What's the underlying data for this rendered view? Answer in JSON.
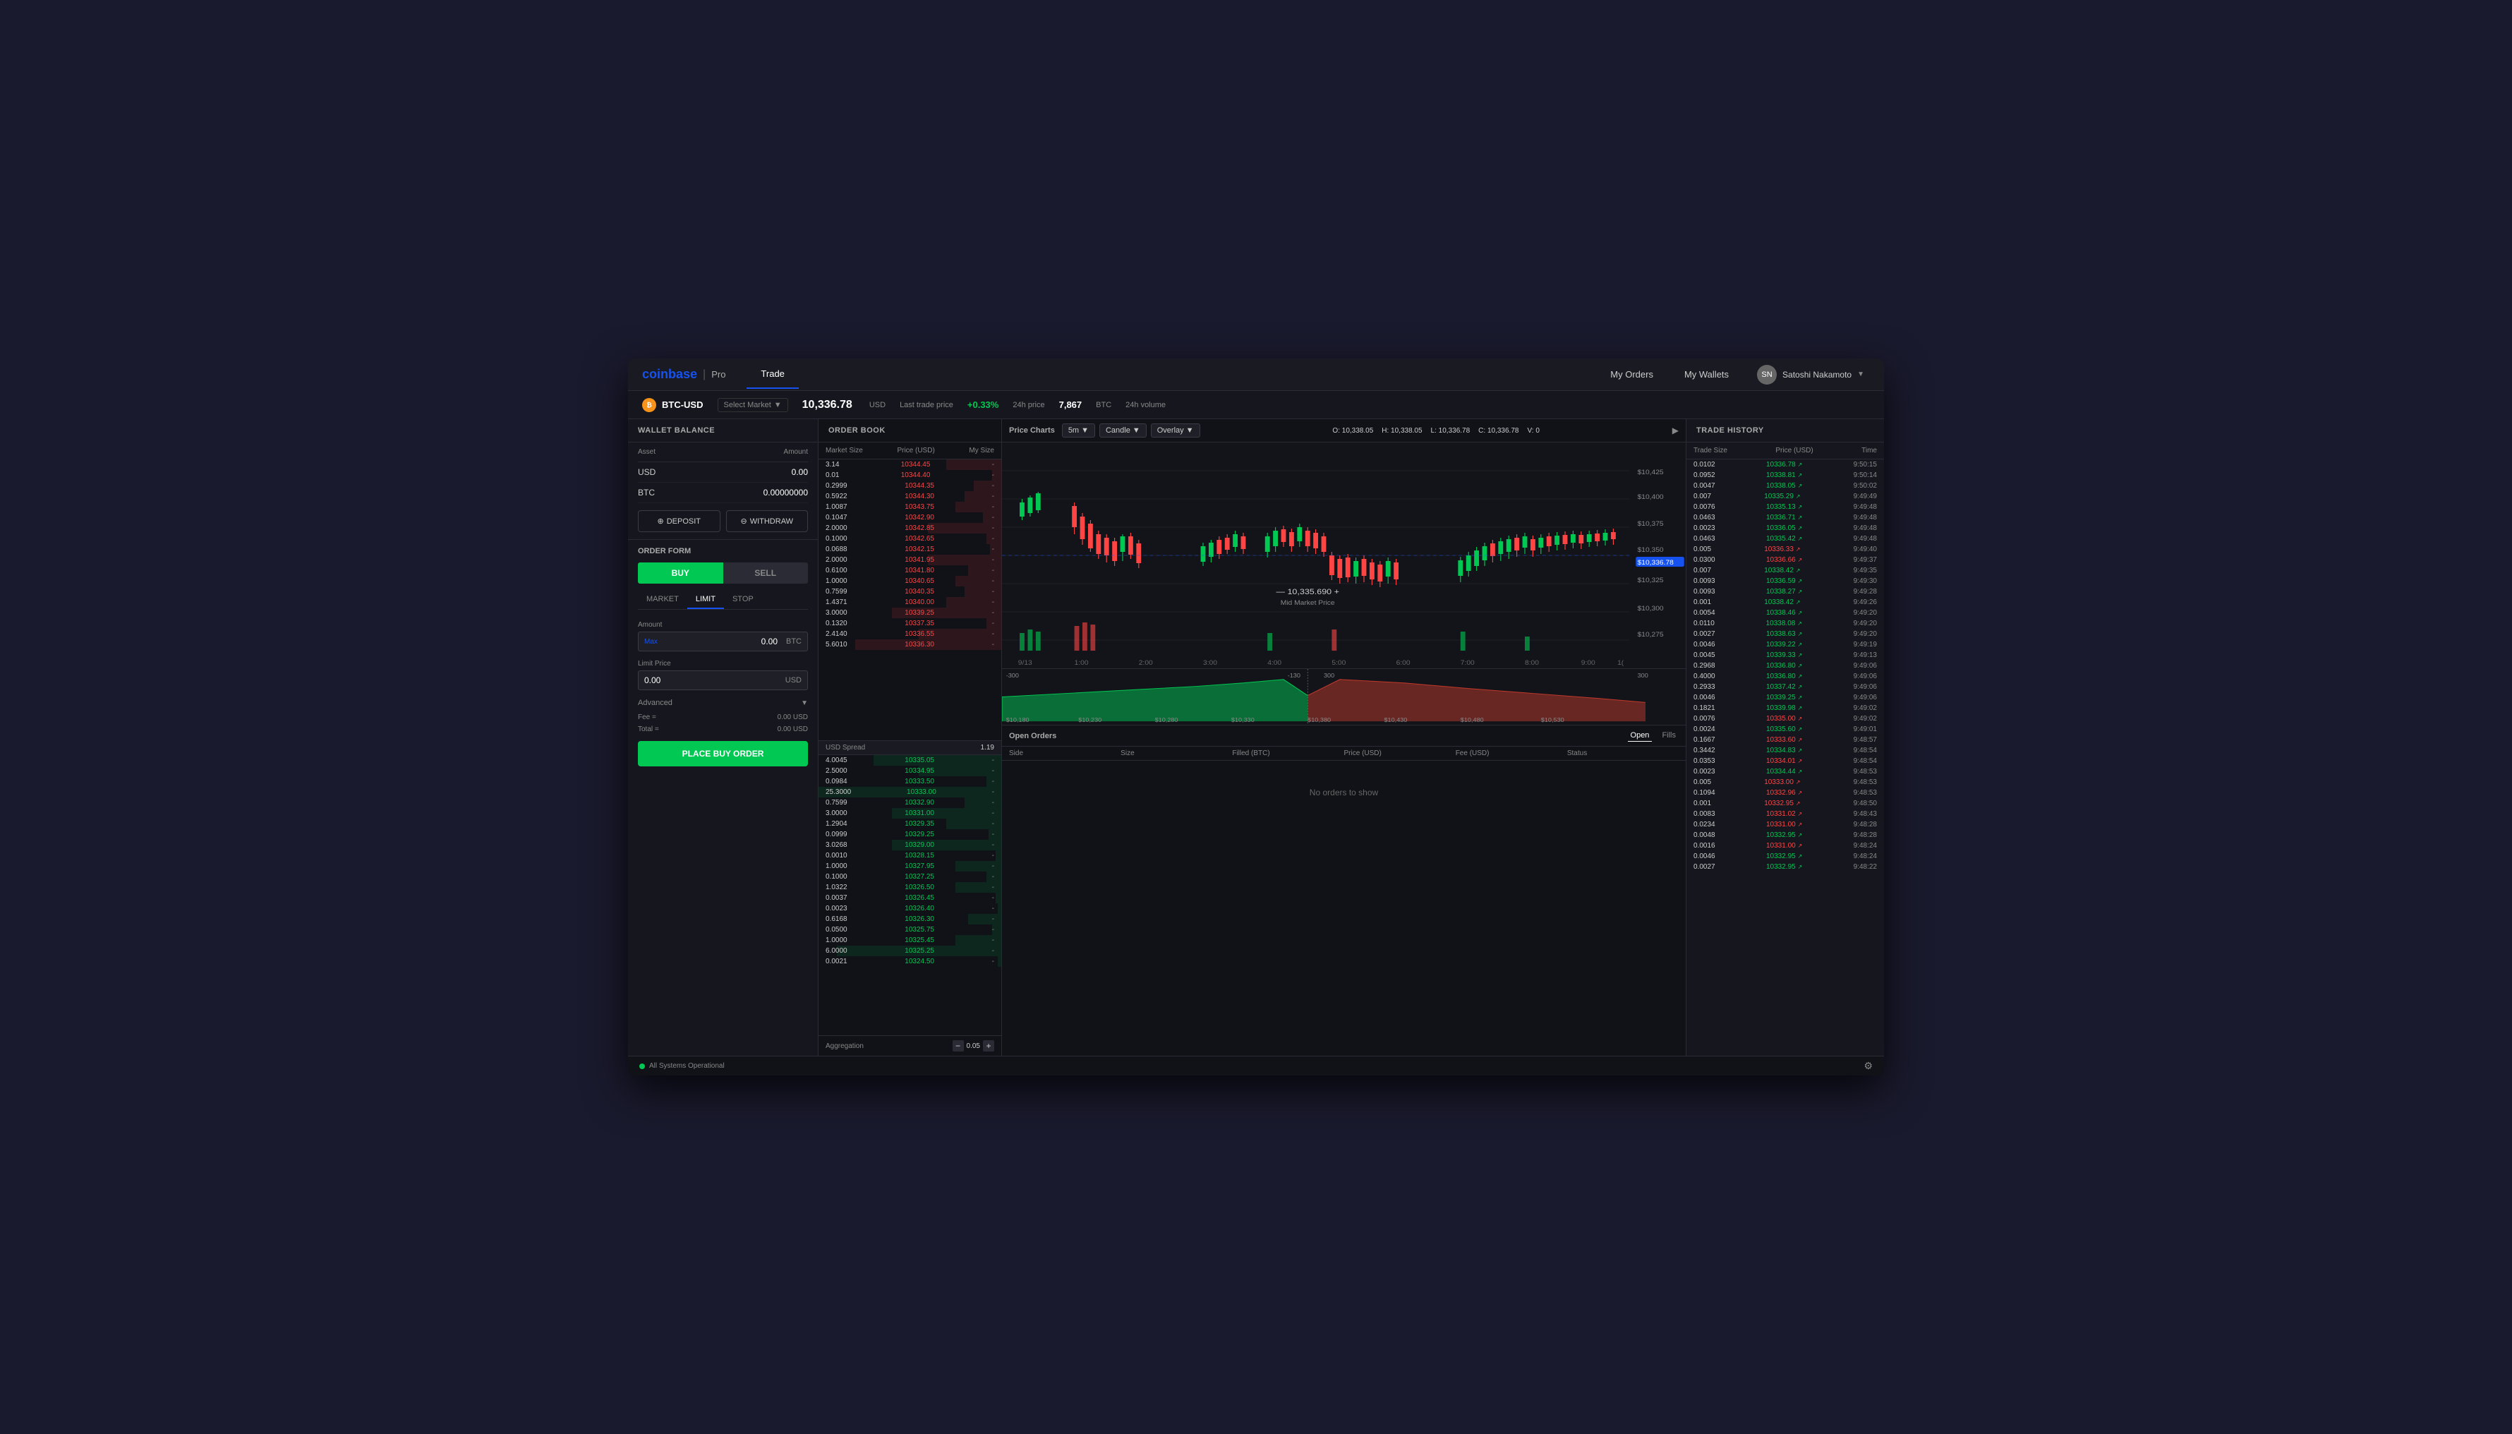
{
  "app": {
    "title": "Coinbase Pro"
  },
  "nav": {
    "logo_main": "coinbase",
    "logo_sub": "Pro",
    "tabs": [
      {
        "label": "Trade",
        "active": true
      }
    ],
    "right_links": [
      "My Orders",
      "My Wallets"
    ],
    "user_name": "Satoshi Nakamoto"
  },
  "market_bar": {
    "pair": "BTC-USD",
    "select_label": "Select Market",
    "last_price": "10,336.78",
    "price_unit": "USD",
    "price_label": "Last trade price",
    "price_change": "+0.33%",
    "change_label": "24h price",
    "volume": "7,867",
    "volume_unit": "BTC",
    "volume_label": "24h volume"
  },
  "sidebar": {
    "wallet_balance_title": "Wallet Balance",
    "col_asset": "Asset",
    "col_amount": "Amount",
    "assets": [
      {
        "name": "USD",
        "amount": "0.00"
      },
      {
        "name": "BTC",
        "amount": "0.00000000"
      }
    ],
    "deposit_label": "DEPOSIT",
    "withdraw_label": "WITHDRAW",
    "order_form_title": "Order Form",
    "buy_label": "BUY",
    "sell_label": "SELL",
    "order_types": [
      "MARKET",
      "LIMIT",
      "STOP"
    ],
    "active_order_type": "LIMIT",
    "amount_label": "Amount",
    "amount_max": "Max",
    "amount_value": "0.00",
    "amount_unit": "BTC",
    "limit_price_label": "Limit Price",
    "limit_price_value": "0.00",
    "limit_price_unit": "USD",
    "advanced_label": "Advanced",
    "fee_label": "Fee =",
    "fee_value": "0.00 USD",
    "total_label": "Total =",
    "total_value": "0.00 USD",
    "place_order_label": "PLACE BUY ORDER"
  },
  "order_book": {
    "title": "Order Book",
    "col_market_size": "Market Size",
    "col_price": "Price (USD)",
    "col_my_size": "My Size",
    "asks": [
      {
        "size": "3.14",
        "price": "10344.45",
        "my_size": "-",
        "pct": 30
      },
      {
        "size": "0.01",
        "price": "10344.40",
        "my_size": "-",
        "pct": 5
      },
      {
        "size": "0.2999",
        "price": "10344.35",
        "my_size": "-",
        "pct": 15
      },
      {
        "size": "0.5922",
        "price": "10344.30",
        "my_size": "-",
        "pct": 20
      },
      {
        "size": "1.0087",
        "price": "10343.75",
        "my_size": "-",
        "pct": 25
      },
      {
        "size": "0.1047",
        "price": "10342.90",
        "my_size": "-",
        "pct": 10
      },
      {
        "size": "2.0000",
        "price": "10342.85",
        "my_size": "-",
        "pct": 40
      },
      {
        "size": "0.1000",
        "price": "10342.65",
        "my_size": "-",
        "pct": 8
      },
      {
        "size": "0.0688",
        "price": "10342.15",
        "my_size": "-",
        "pct": 6
      },
      {
        "size": "2.0000",
        "price": "10341.95",
        "my_size": "-",
        "pct": 40
      },
      {
        "size": "0.6100",
        "price": "10341.80",
        "my_size": "-",
        "pct": 18
      },
      {
        "size": "1.0000",
        "price": "10340.65",
        "my_size": "-",
        "pct": 25
      },
      {
        "size": "0.7599",
        "price": "10340.35",
        "my_size": "-",
        "pct": 20
      },
      {
        "size": "1.4371",
        "price": "10340.00",
        "my_size": "-",
        "pct": 30
      },
      {
        "size": "3.0000",
        "price": "10339.25",
        "my_size": "-",
        "pct": 60
      },
      {
        "size": "0.1320",
        "price": "10337.35",
        "my_size": "-",
        "pct": 8
      },
      {
        "size": "2.4140",
        "price": "10336.55",
        "my_size": "-",
        "pct": 45
      },
      {
        "size": "5.6010",
        "price": "10336.30",
        "my_size": "-",
        "pct": 80
      }
    ],
    "spread_label": "USD Spread",
    "spread_value": "1.19",
    "bids": [
      {
        "size": "4.0045",
        "price": "10335.05",
        "my_size": "-",
        "pct": 70
      },
      {
        "size": "2.5000",
        "price": "10334.95",
        "my_size": "-",
        "pct": 45
      },
      {
        "size": "0.0984",
        "price": "10333.50",
        "my_size": "-",
        "pct": 8
      },
      {
        "size": "25.3000",
        "price": "10333.00",
        "my_size": "-",
        "pct": 100
      },
      {
        "size": "0.7599",
        "price": "10332.90",
        "my_size": "-",
        "pct": 20
      },
      {
        "size": "3.0000",
        "price": "10331.00",
        "my_size": "-",
        "pct": 60
      },
      {
        "size": "1.2904",
        "price": "10329.35",
        "my_size": "-",
        "pct": 30
      },
      {
        "size": "0.0999",
        "price": "10329.25",
        "my_size": "-",
        "pct": 7
      },
      {
        "size": "3.0268",
        "price": "10329.00",
        "my_size": "-",
        "pct": 60
      },
      {
        "size": "0.0010",
        "price": "10328.15",
        "my_size": "-",
        "pct": 3
      },
      {
        "size": "1.0000",
        "price": "10327.95",
        "my_size": "-",
        "pct": 25
      },
      {
        "size": "0.1000",
        "price": "10327.25",
        "my_size": "-",
        "pct": 8
      },
      {
        "size": "1.0322",
        "price": "10326.50",
        "my_size": "-",
        "pct": 25
      },
      {
        "size": "0.0037",
        "price": "10326.45",
        "my_size": "-",
        "pct": 3
      },
      {
        "size": "0.0023",
        "price": "10326.40",
        "my_size": "-",
        "pct": 2
      },
      {
        "size": "0.6168",
        "price": "10326.30",
        "my_size": "-",
        "pct": 18
      },
      {
        "size": "0.0500",
        "price": "10325.75",
        "my_size": "-",
        "pct": 5
      },
      {
        "size": "1.0000",
        "price": "10325.45",
        "my_size": "-",
        "pct": 25
      },
      {
        "size": "6.0000",
        "price": "10325.25",
        "my_size": "-",
        "pct": 90
      },
      {
        "size": "0.0021",
        "price": "10324.50",
        "my_size": "-",
        "pct": 2
      }
    ],
    "aggregation_label": "Aggregation",
    "aggregation_value": "0.05"
  },
  "price_charts": {
    "title": "Price Charts",
    "timeframe": "5m",
    "chart_type": "Candle",
    "overlay": "Overlay",
    "ohlcv": {
      "o_label": "O:",
      "o_val": "10,338.05",
      "h_label": "H:",
      "h_val": "10,338.05",
      "l_label": "L:",
      "l_val": "10,336.78",
      "c_label": "C:",
      "c_val": "10,336.78",
      "v_label": "V:",
      "v_val": "0"
    },
    "price_ticks": [
      "$10,425",
      "$10,400",
      "$10,375",
      "$10,350",
      "$10,336.78",
      "$10,325",
      "$10,300",
      "$10,275"
    ],
    "mid_market_price": "10,335.690",
    "mid_market_label": "Mid Market Price",
    "time_labels": [
      "9/13",
      "1:00",
      "2:00",
      "3:00",
      "4:00",
      "5:00",
      "6:00",
      "7:00",
      "8:00",
      "9:00",
      "1("
    ],
    "depth_labels_left": [
      "-300",
      "-130"
    ],
    "depth_labels_right": [
      "300",
      "300"
    ],
    "depth_prices": [
      "$10,180",
      "$10,230",
      "$10,280",
      "$10,330",
      "$10,380",
      "$10,430",
      "$10,480",
      "$10,530"
    ]
  },
  "open_orders": {
    "title": "Open Orders",
    "tab_open": "Open",
    "tab_fills": "Fills",
    "col_side": "Side",
    "col_size": "Size",
    "col_filled": "Filled (BTC)",
    "col_price": "Price (USD)",
    "col_fee": "Fee (USD)",
    "col_status": "Status",
    "empty_message": "No orders to show"
  },
  "trade_history": {
    "title": "Trade History",
    "col_trade_size": "Trade Size",
    "col_price": "Price (USD)",
    "col_time": "Time",
    "trades": [
      {
        "size": "0.0102",
        "price": "10336.78",
        "dir": "up",
        "time": "9:50:15"
      },
      {
        "size": "0.0952",
        "price": "10338.81",
        "dir": "up",
        "time": "9:50:14"
      },
      {
        "size": "0.0047",
        "price": "10338.05",
        "dir": "up",
        "time": "9:50:02"
      },
      {
        "size": "0.007",
        "price": "10335.29",
        "dir": "up",
        "time": "9:49:49"
      },
      {
        "size": "0.0076",
        "price": "10335.13",
        "dir": "up",
        "time": "9:49:48"
      },
      {
        "size": "0.0463",
        "price": "10336.71",
        "dir": "up",
        "time": "9:49:48"
      },
      {
        "size": "0.0023",
        "price": "10336.05",
        "dir": "up",
        "time": "9:49:48"
      },
      {
        "size": "0.0463",
        "price": "10335.42",
        "dir": "up",
        "time": "9:49:48"
      },
      {
        "size": "0.005",
        "price": "10336.33",
        "dir": "down",
        "time": "9:49:40"
      },
      {
        "size": "0.0300",
        "price": "10336.66",
        "dir": "down",
        "time": "9:49:37"
      },
      {
        "size": "0.007",
        "price": "10338.42",
        "dir": "up",
        "time": "9:49:35"
      },
      {
        "size": "0.0093",
        "price": "10336.59",
        "dir": "up",
        "time": "9:49:30"
      },
      {
        "size": "0.0093",
        "price": "10338.27",
        "dir": "up",
        "time": "9:49:28"
      },
      {
        "size": "0.001",
        "price": "10338.42",
        "dir": "up",
        "time": "9:49:26"
      },
      {
        "size": "0.0054",
        "price": "10338.46",
        "dir": "up",
        "time": "9:49:20"
      },
      {
        "size": "0.0110",
        "price": "10338.08",
        "dir": "up",
        "time": "9:49:20"
      },
      {
        "size": "0.0027",
        "price": "10338.63",
        "dir": "up",
        "time": "9:49:20"
      },
      {
        "size": "0.0046",
        "price": "10339.22",
        "dir": "up",
        "time": "9:49:19"
      },
      {
        "size": "0.0045",
        "price": "10339.33",
        "dir": "up",
        "time": "9:49:13"
      },
      {
        "size": "0.2968",
        "price": "10336.80",
        "dir": "up",
        "time": "9:49:06"
      },
      {
        "size": "0.4000",
        "price": "10336.80",
        "dir": "up",
        "time": "9:49:06"
      },
      {
        "size": "0.2933",
        "price": "10337.42",
        "dir": "up",
        "time": "9:49:06"
      },
      {
        "size": "0.0046",
        "price": "10339.25",
        "dir": "up",
        "time": "9:49:06"
      },
      {
        "size": "0.1821",
        "price": "10339.98",
        "dir": "up",
        "time": "9:49:02"
      },
      {
        "size": "0.0076",
        "price": "10335.00",
        "dir": "down",
        "time": "9:49:02"
      },
      {
        "size": "0.0024",
        "price": "10335.60",
        "dir": "up",
        "time": "9:49:01"
      },
      {
        "size": "0.1667",
        "price": "10333.60",
        "dir": "down",
        "time": "9:48:57"
      },
      {
        "size": "0.3442",
        "price": "10334.83",
        "dir": "up",
        "time": "9:48:54"
      },
      {
        "size": "0.0353",
        "price": "10334.01",
        "dir": "down",
        "time": "9:48:54"
      },
      {
        "size": "0.0023",
        "price": "10334.44",
        "dir": "up",
        "time": "9:48:53"
      },
      {
        "size": "0.005",
        "price": "10333.00",
        "dir": "down",
        "time": "9:48:53"
      },
      {
        "size": "0.1094",
        "price": "10332.96",
        "dir": "down",
        "time": "9:48:53"
      },
      {
        "size": "0.001",
        "price": "10332.95",
        "dir": "down",
        "time": "9:48:50"
      },
      {
        "size": "0.0083",
        "price": "10331.02",
        "dir": "down",
        "time": "9:48:43"
      },
      {
        "size": "0.0234",
        "price": "10331.00",
        "dir": "down",
        "time": "9:48:28"
      },
      {
        "size": "0.0048",
        "price": "10332.95",
        "dir": "up",
        "time": "9:48:28"
      },
      {
        "size": "0.0016",
        "price": "10331.00",
        "dir": "down",
        "time": "9:48:24"
      },
      {
        "size": "0.0046",
        "price": "10332.95",
        "dir": "up",
        "time": "9:48:24"
      },
      {
        "size": "0.0027",
        "price": "10332.95",
        "dir": "up",
        "time": "9:48:22"
      }
    ]
  },
  "status_bar": {
    "status_text": "All Systems Operational",
    "status_color": "#00c853"
  }
}
